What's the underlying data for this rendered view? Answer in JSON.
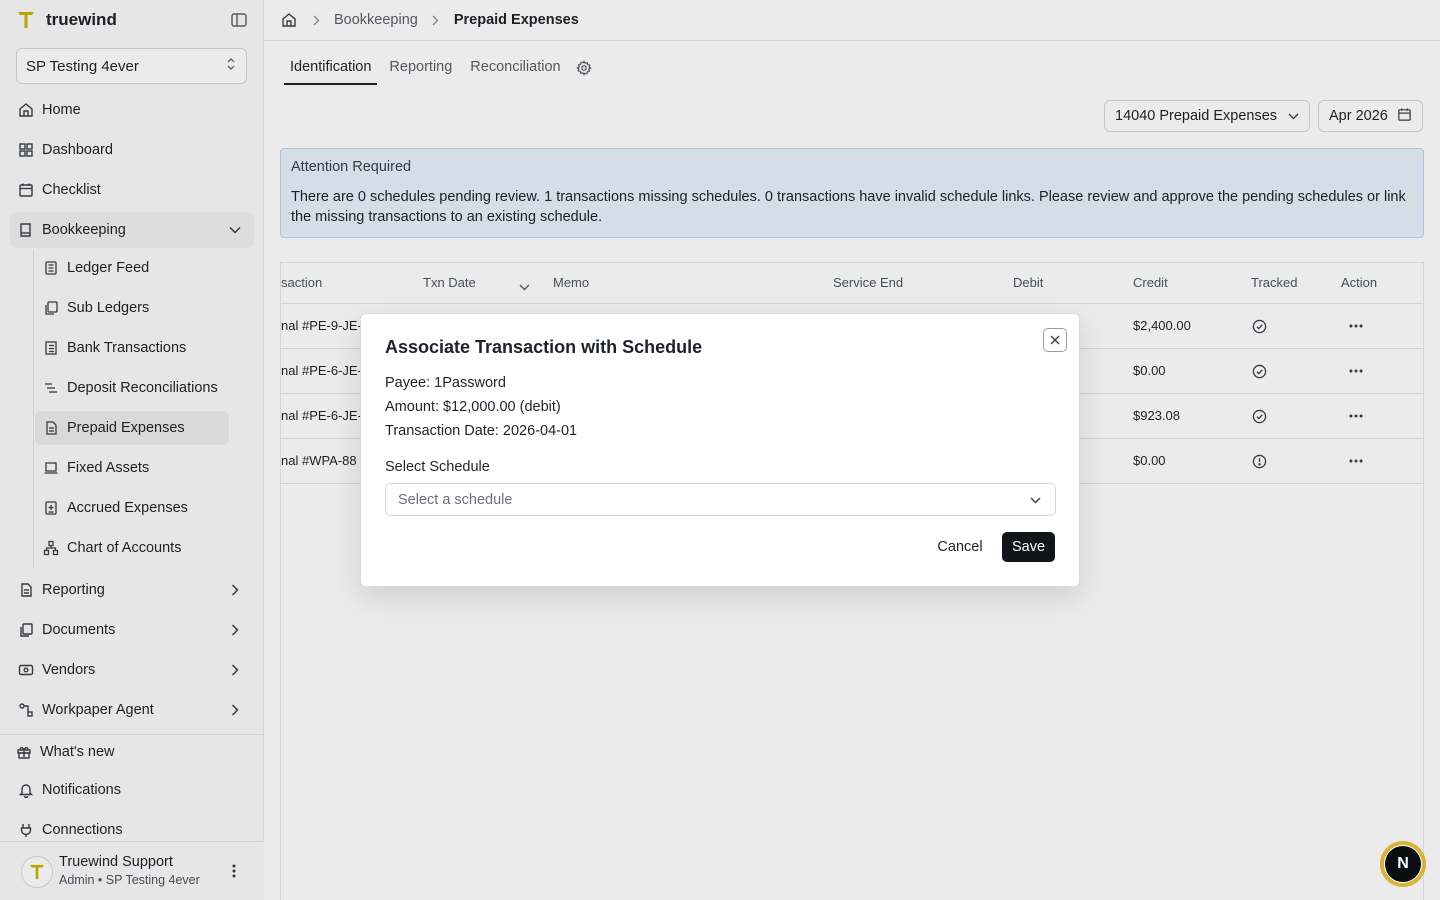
{
  "brand": {
    "name": "truewind"
  },
  "org_select": {
    "value": "SP Testing 4ever"
  },
  "nav": {
    "home": "Home",
    "dashboard": "Dashboard",
    "checklist": "Checklist",
    "bookkeeping": "Bookkeeping",
    "sub": [
      "Ledger Feed",
      "Sub Ledgers",
      "Bank Transactions",
      "Deposit Reconciliations",
      "Prepaid Expenses",
      "Fixed Assets",
      "Accrued Expenses",
      "Chart of Accounts"
    ],
    "reporting": "Reporting",
    "documents": "Documents",
    "vendors": "Vendors",
    "workpaper": "Workpaper Agent",
    "whats_new": "What's new",
    "notifications": "Notifications",
    "connections": "Connections"
  },
  "user": {
    "name": "Truewind Support",
    "role": "Admin • SP Testing 4ever"
  },
  "breadcrumb": {
    "section": "Bookkeeping",
    "current": "Prepaid Expenses"
  },
  "tabs": [
    "Identification",
    "Reporting",
    "Reconciliation"
  ],
  "filters": {
    "account": "14040 Prepaid Expenses",
    "period": "Apr 2026"
  },
  "alert": {
    "title": "Attention Required",
    "body": "There are 0 schedules pending review. 1 transactions missing schedules. 0 transactions have invalid schedule links. Please review and approve the pending schedules or link the missing transactions to an existing schedule."
  },
  "table": {
    "headers": {
      "transaction": "saction",
      "txn_date": "Txn Date",
      "memo": "Memo",
      "service_end": "Service End",
      "debit": "Debit",
      "credit": "Credit",
      "tracked": "Tracked",
      "action": "Action"
    },
    "rows": [
      {
        "transaction": "nal #PE-9-JE-",
        "credit": "$2,400.00",
        "tracked": "check"
      },
      {
        "transaction": "nal #PE-6-JE-",
        "credit": "$0.00",
        "tracked": "check"
      },
      {
        "transaction": "nal #PE-6-JE-",
        "credit": "$923.08",
        "tracked": "check"
      },
      {
        "transaction": "nal #WPA-88",
        "credit": "$0.00",
        "tracked": "alert"
      }
    ]
  },
  "modal": {
    "title": "Associate Transaction with Schedule",
    "payee": "Payee: 1Password",
    "amount": "Amount: $12,000.00 (debit)",
    "txn_date": "Transaction Date: 2026-04-01",
    "field_label": "Select Schedule",
    "placeholder": "Select a schedule",
    "cancel": "Cancel",
    "save": "Save"
  },
  "badge": {
    "letter": "N"
  },
  "colors": {
    "accent": "#111418",
    "alert_bg": "#e8f0fb",
    "alert_border": "#bcd3ee",
    "logo": "#c9b400"
  }
}
